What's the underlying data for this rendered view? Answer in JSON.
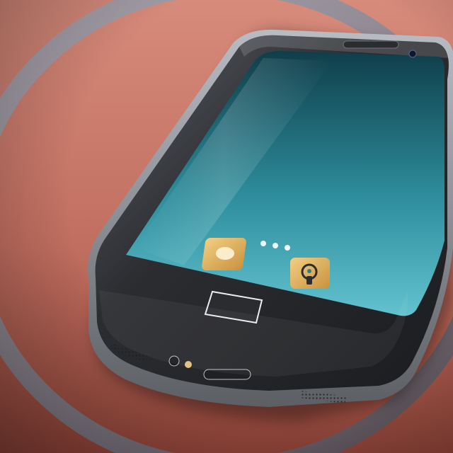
{
  "scene": {
    "colors": {
      "cushion": "#c46d5e",
      "cushion_dark": "#8e4338",
      "cushion_light": "#d9897a",
      "rim_metal": "#b7b7b7",
      "phone_body": "#2a2c30",
      "phone_edge": "#8f9196",
      "screen_top": "#0f3e4a",
      "screen_mid": "#2e8d9c",
      "screen_bottom": "#63c2cf",
      "home_button_outline": "#e9eef2",
      "app_icon_gold": "#e8b765",
      "app_icon_gold_dark": "#c8923e"
    },
    "icons": [
      {
        "name": "photos-app-icon"
      },
      {
        "name": "settings-app-icon"
      },
      {
        "name": "more-dots-icon"
      },
      {
        "name": "home-button"
      },
      {
        "name": "earpiece-speaker"
      },
      {
        "name": "front-camera"
      },
      {
        "name": "bottom-speaker-grille"
      },
      {
        "name": "charging-port"
      }
    ]
  }
}
